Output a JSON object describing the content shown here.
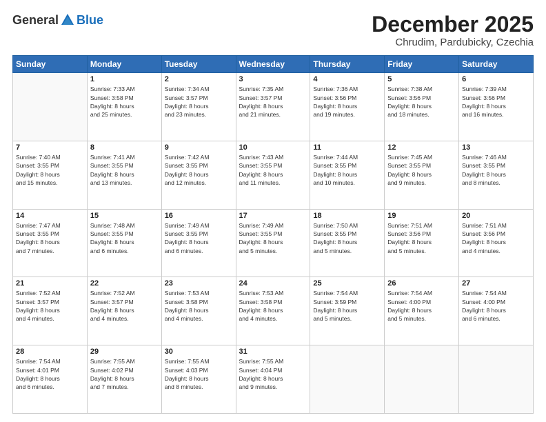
{
  "header": {
    "logo": {
      "general": "General",
      "blue": "Blue"
    },
    "title": "December 2025",
    "location": "Chrudim, Pardubicky, Czechia"
  },
  "days_of_week": [
    "Sunday",
    "Monday",
    "Tuesday",
    "Wednesday",
    "Thursday",
    "Friday",
    "Saturday"
  ],
  "weeks": [
    [
      {
        "num": "",
        "info": ""
      },
      {
        "num": "1",
        "info": "Sunrise: 7:33 AM\nSunset: 3:58 PM\nDaylight: 8 hours\nand 25 minutes."
      },
      {
        "num": "2",
        "info": "Sunrise: 7:34 AM\nSunset: 3:57 PM\nDaylight: 8 hours\nand 23 minutes."
      },
      {
        "num": "3",
        "info": "Sunrise: 7:35 AM\nSunset: 3:57 PM\nDaylight: 8 hours\nand 21 minutes."
      },
      {
        "num": "4",
        "info": "Sunrise: 7:36 AM\nSunset: 3:56 PM\nDaylight: 8 hours\nand 19 minutes."
      },
      {
        "num": "5",
        "info": "Sunrise: 7:38 AM\nSunset: 3:56 PM\nDaylight: 8 hours\nand 18 minutes."
      },
      {
        "num": "6",
        "info": "Sunrise: 7:39 AM\nSunset: 3:56 PM\nDaylight: 8 hours\nand 16 minutes."
      }
    ],
    [
      {
        "num": "7",
        "info": "Sunrise: 7:40 AM\nSunset: 3:55 PM\nDaylight: 8 hours\nand 15 minutes."
      },
      {
        "num": "8",
        "info": "Sunrise: 7:41 AM\nSunset: 3:55 PM\nDaylight: 8 hours\nand 13 minutes."
      },
      {
        "num": "9",
        "info": "Sunrise: 7:42 AM\nSunset: 3:55 PM\nDaylight: 8 hours\nand 12 minutes."
      },
      {
        "num": "10",
        "info": "Sunrise: 7:43 AM\nSunset: 3:55 PM\nDaylight: 8 hours\nand 11 minutes."
      },
      {
        "num": "11",
        "info": "Sunrise: 7:44 AM\nSunset: 3:55 PM\nDaylight: 8 hours\nand 10 minutes."
      },
      {
        "num": "12",
        "info": "Sunrise: 7:45 AM\nSunset: 3:55 PM\nDaylight: 8 hours\nand 9 minutes."
      },
      {
        "num": "13",
        "info": "Sunrise: 7:46 AM\nSunset: 3:55 PM\nDaylight: 8 hours\nand 8 minutes."
      }
    ],
    [
      {
        "num": "14",
        "info": "Sunrise: 7:47 AM\nSunset: 3:55 PM\nDaylight: 8 hours\nand 7 minutes."
      },
      {
        "num": "15",
        "info": "Sunrise: 7:48 AM\nSunset: 3:55 PM\nDaylight: 8 hours\nand 6 minutes."
      },
      {
        "num": "16",
        "info": "Sunrise: 7:49 AM\nSunset: 3:55 PM\nDaylight: 8 hours\nand 6 minutes."
      },
      {
        "num": "17",
        "info": "Sunrise: 7:49 AM\nSunset: 3:55 PM\nDaylight: 8 hours\nand 5 minutes."
      },
      {
        "num": "18",
        "info": "Sunrise: 7:50 AM\nSunset: 3:55 PM\nDaylight: 8 hours\nand 5 minutes."
      },
      {
        "num": "19",
        "info": "Sunrise: 7:51 AM\nSunset: 3:56 PM\nDaylight: 8 hours\nand 5 minutes."
      },
      {
        "num": "20",
        "info": "Sunrise: 7:51 AM\nSunset: 3:56 PM\nDaylight: 8 hours\nand 4 minutes."
      }
    ],
    [
      {
        "num": "21",
        "info": "Sunrise: 7:52 AM\nSunset: 3:57 PM\nDaylight: 8 hours\nand 4 minutes."
      },
      {
        "num": "22",
        "info": "Sunrise: 7:52 AM\nSunset: 3:57 PM\nDaylight: 8 hours\nand 4 minutes."
      },
      {
        "num": "23",
        "info": "Sunrise: 7:53 AM\nSunset: 3:58 PM\nDaylight: 8 hours\nand 4 minutes."
      },
      {
        "num": "24",
        "info": "Sunrise: 7:53 AM\nSunset: 3:58 PM\nDaylight: 8 hours\nand 4 minutes."
      },
      {
        "num": "25",
        "info": "Sunrise: 7:54 AM\nSunset: 3:59 PM\nDaylight: 8 hours\nand 5 minutes."
      },
      {
        "num": "26",
        "info": "Sunrise: 7:54 AM\nSunset: 4:00 PM\nDaylight: 8 hours\nand 5 minutes."
      },
      {
        "num": "27",
        "info": "Sunrise: 7:54 AM\nSunset: 4:00 PM\nDaylight: 8 hours\nand 6 minutes."
      }
    ],
    [
      {
        "num": "28",
        "info": "Sunrise: 7:54 AM\nSunset: 4:01 PM\nDaylight: 8 hours\nand 6 minutes."
      },
      {
        "num": "29",
        "info": "Sunrise: 7:55 AM\nSunset: 4:02 PM\nDaylight: 8 hours\nand 7 minutes."
      },
      {
        "num": "30",
        "info": "Sunrise: 7:55 AM\nSunset: 4:03 PM\nDaylight: 8 hours\nand 8 minutes."
      },
      {
        "num": "31",
        "info": "Sunrise: 7:55 AM\nSunset: 4:04 PM\nDaylight: 8 hours\nand 9 minutes."
      },
      {
        "num": "",
        "info": ""
      },
      {
        "num": "",
        "info": ""
      },
      {
        "num": "",
        "info": ""
      }
    ]
  ]
}
